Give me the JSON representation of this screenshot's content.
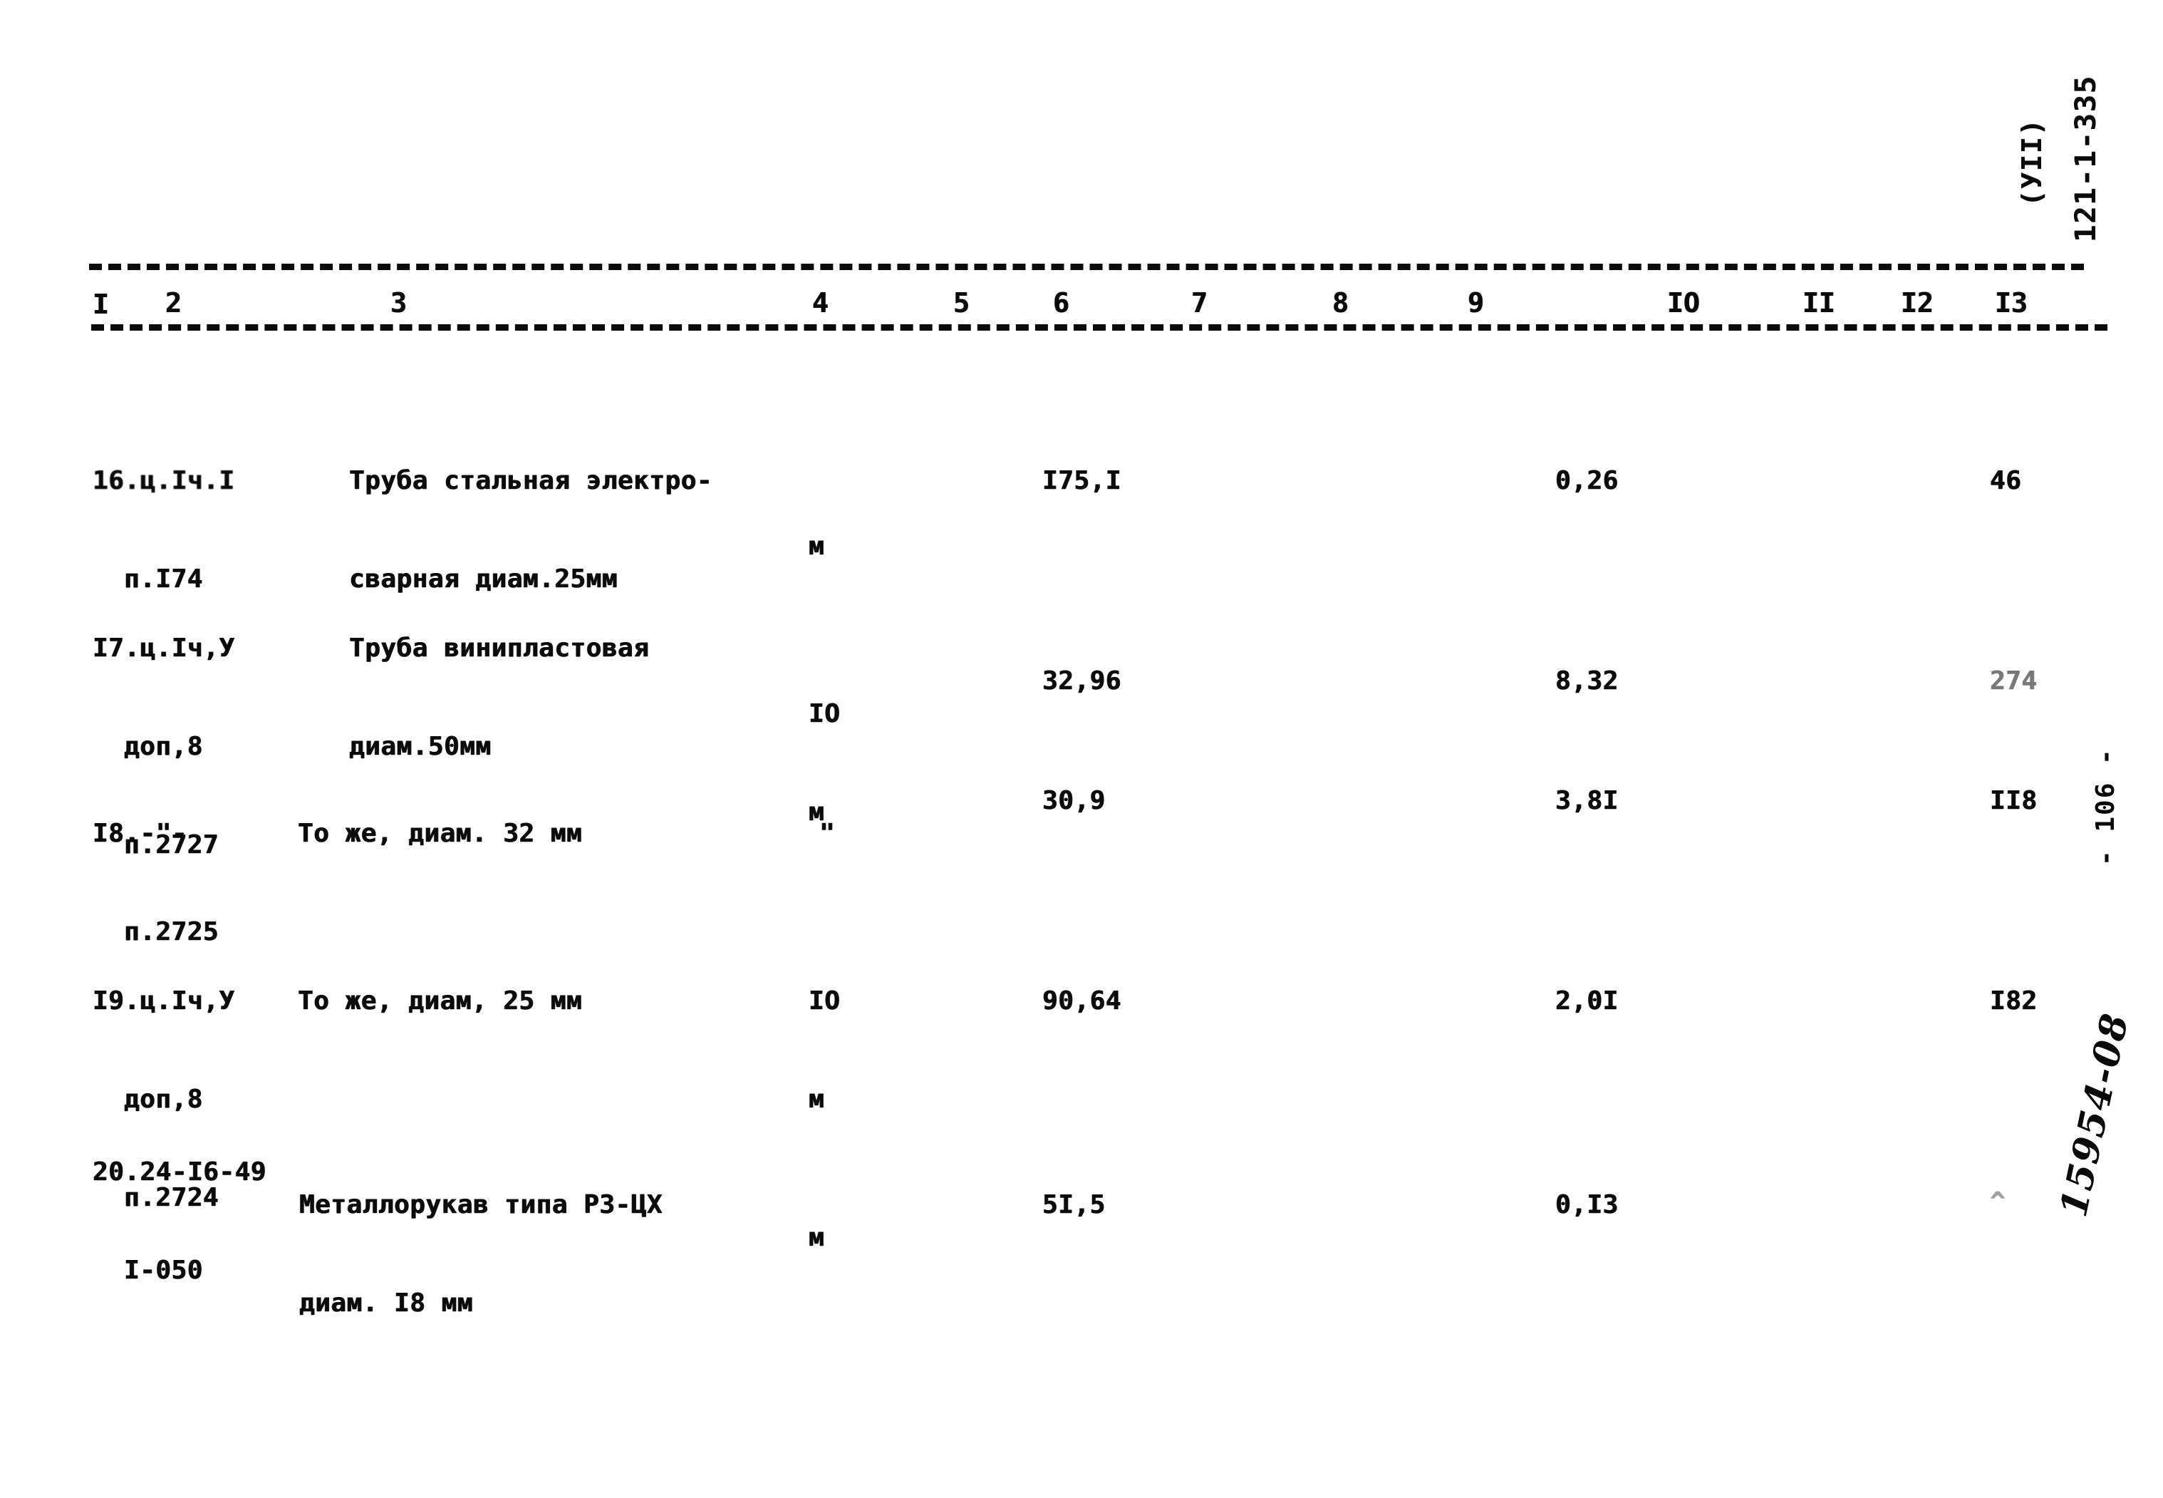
{
  "document": {
    "doc_number": "121-1-335",
    "doc_section": "(УII)",
    "page_number": "- 106 -",
    "archive_stamp": "15954-08"
  },
  "table": {
    "column_numbers": [
      "I",
      "2",
      "3",
      "4",
      "5",
      "6",
      "7",
      "8",
      "9",
      "IO",
      "II",
      "I2",
      "I3"
    ],
    "rows": [
      {
        "code_lines": [
          "16.ц.Iч.I",
          "п.I74"
        ],
        "description_lines": [
          "Труба стальная электро-",
          "сварная диам.25мм"
        ],
        "unit_lines": [
          "",
          "м"
        ],
        "quantity": "I75,I",
        "col9": "0,26",
        "col12": "46"
      },
      {
        "code_lines": [
          "I7.ц.Iч,У",
          "доп,8",
          "п.2727"
        ],
        "description_lines": [
          "Труба винипластовая",
          "диам.50мм"
        ],
        "unit_lines": [
          "",
          "IO",
          "м"
        ],
        "quantity": "32,96",
        "col9": "8,32",
        "col12": "274"
      },
      {
        "code_lines": [
          "I8.-\"-",
          "п.2725"
        ],
        "description_lines": [
          "То же, диам. 32 мм"
        ],
        "unit_lines": [
          "\""
        ],
        "quantity": "30,9",
        "col9": "3,8I",
        "col12": "II8"
      },
      {
        "code_lines": [
          "I9.ц.Iч,У",
          "доп,8",
          "п.2724"
        ],
        "description_lines": [
          "То же, диам, 25 мм"
        ],
        "unit_lines": [
          "IO",
          "м"
        ],
        "quantity": "90,64",
        "col9": "2,0I",
        "col12": "I82"
      },
      {
        "code_lines": [
          "20.24-I6-49",
          "I-050"
        ],
        "description_lines": [
          "Металлорукав типа РЗ-ЦХ",
          "диам. I8 мм"
        ],
        "unit_lines": [
          "",
          "м"
        ],
        "quantity": "5I,5",
        "col9": "0,I3",
        "col12": "^"
      }
    ]
  }
}
